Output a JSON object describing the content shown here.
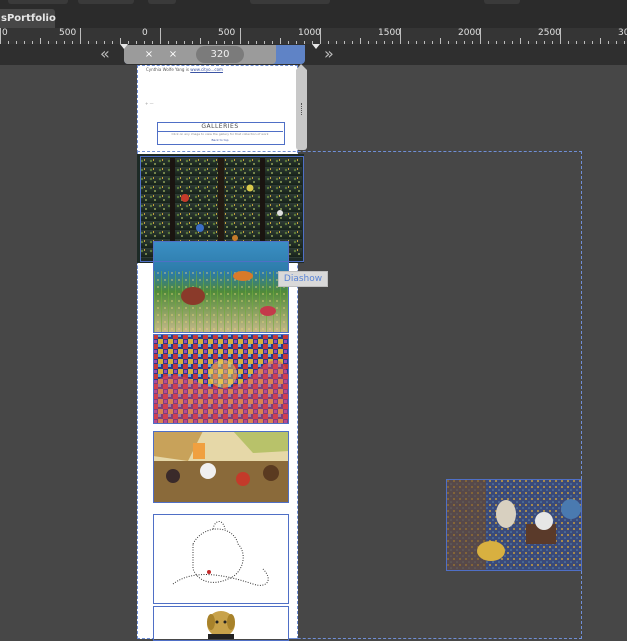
{
  "document": {
    "tab_label": "sPortfolio"
  },
  "ruler": {
    "labels": [
      "0",
      "500",
      "0",
      "500",
      "1000",
      "1500",
      "2000",
      "2500",
      "30"
    ]
  },
  "breakpoints": {
    "width_value": "320",
    "close_symbol": "×",
    "arrow_left": "«",
    "arrow_right": "»"
  },
  "page_content": {
    "caption_prefix": "Cynthia Wolfe Yang is ",
    "caption_link": "www.cityo...com",
    "side_mark": "+ —",
    "galleries_title": "GALLERIES",
    "galleries_desc": "Click on any image to view the gallery for that collection of work",
    "galleries_link": "Back to top"
  },
  "widget": {
    "label": "Diashow"
  },
  "handle": {
    "grip": "⋮"
  },
  "colors": {
    "workspace": "#474747",
    "guide_blue": "#6f8fd6",
    "breakpoint_blue": "#5f83c6",
    "label_blue": "#5b85d6"
  }
}
